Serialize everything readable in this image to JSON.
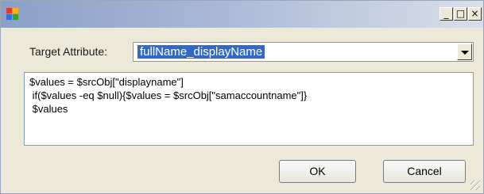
{
  "window": {
    "title": "",
    "app_icon": "app-window-icon",
    "controls": {
      "minimize": "_",
      "maximize": "□",
      "close": "×"
    }
  },
  "form": {
    "target_attribute_label": "Target Attribute:",
    "target_attribute_value": "fullName_displayName",
    "script_lines": [
      "$values = $srcObj[\"displayname\"]",
      " if($values -eq $null){$values = $srcObj[\"samaccountname\"]}",
      " $values"
    ]
  },
  "buttons": {
    "ok": "OK",
    "cancel": "Cancel"
  },
  "colors": {
    "selection": "#316ac5",
    "face": "#ece9d8",
    "field_border": "#7f9db9"
  }
}
